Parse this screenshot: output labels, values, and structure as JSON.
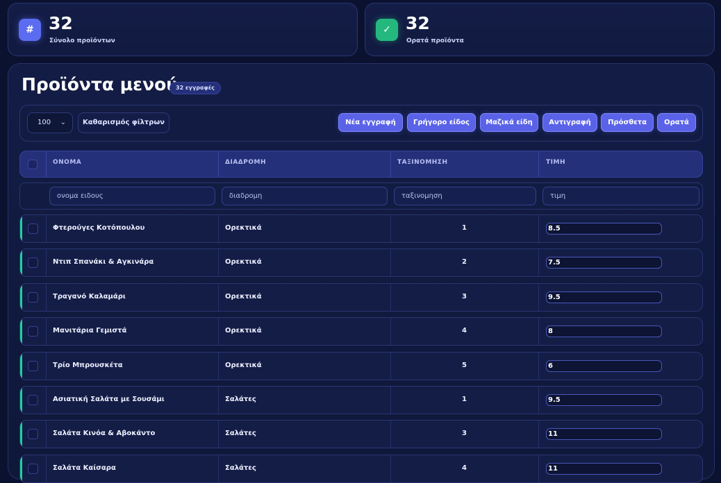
{
  "stats": [
    {
      "value": "32",
      "label": "Σύνολο προϊόντων",
      "icon": "hash-icon",
      "glyph": "#",
      "color": "#5b6cf0"
    },
    {
      "value": "32",
      "label": "Ορατά προϊόντα",
      "icon": "check-icon",
      "glyph": "✓",
      "color": "#25b87e"
    }
  ],
  "page": {
    "title": "Προϊόντα μενού",
    "count_badge": "32 εγγραφές"
  },
  "toolbar": {
    "page_size": "100",
    "clear_filters": "Καθαρισμός φίλτρων",
    "actions": [
      "Νέα εγγραφή",
      "Γρήγορο είδος",
      "Μαζικά είδη",
      "Αντιγραφή",
      "Πρόσθετα",
      "Ορατά"
    ],
    "accent_color": "#5a63e8"
  },
  "table": {
    "columns": [
      "ΟΝΟΜΑ",
      "ΔΙΑΔΡΟΜΗ",
      "ΤΑΞΙΝΟΜΗΣΗ",
      "ΤΙΜΗ"
    ],
    "filter_placeholders": [
      "ονομα ειδους",
      "διαδρομη",
      "ταξινομηση",
      "τιμη"
    ],
    "rows": [
      {
        "name": "Φτερούγες Κοτόπουλου",
        "route": "Ορεκτικά",
        "sort": "1",
        "price": "8.5"
      },
      {
        "name": "Ντιπ Σπανάκι & Αγκινάρα",
        "route": "Ορεκτικά",
        "sort": "2",
        "price": "7.5"
      },
      {
        "name": "Τραγανό Καλαμάρι",
        "route": "Ορεκτικά",
        "sort": "3",
        "price": "9.5"
      },
      {
        "name": "Μανιτάρια Γεμιστά",
        "route": "Ορεκτικά",
        "sort": "4",
        "price": "8"
      },
      {
        "name": "Τρίο Μπρουσκέτα",
        "route": "Ορεκτικά",
        "sort": "5",
        "price": "6"
      },
      {
        "name": "Ασιατική Σαλάτα με Σουσάμι",
        "route": "Σαλάτες",
        "sort": "1",
        "price": "9.5"
      },
      {
        "name": "Σαλάτα Κινόα & Αβοκάντο",
        "route": "Σαλάτες",
        "sort": "3",
        "price": "11"
      },
      {
        "name": "Σαλάτα Καίσαρα",
        "route": "Σαλάτες",
        "sort": "4",
        "price": "11"
      }
    ],
    "row_accent_color": "#1fd0a0"
  }
}
